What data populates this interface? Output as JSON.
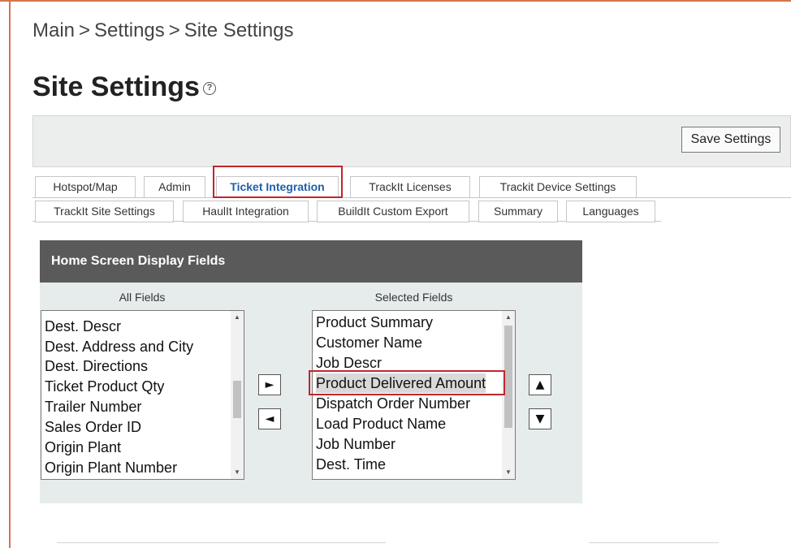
{
  "breadcrumb": {
    "items": [
      "Main",
      "Settings",
      "Site Settings"
    ],
    "separator": ">"
  },
  "page": {
    "title": "Site Settings",
    "help_icon": "?"
  },
  "toolbar": {
    "save_label": "Save Settings"
  },
  "tabs": {
    "row1": [
      "Hotspot/Map",
      "Admin",
      "Ticket Integration",
      "TrackIt Licenses",
      "Trackit Device Settings"
    ],
    "row2": [
      "TrackIt Site Settings",
      "HaulIt Integration",
      "BuildIt Custom Export",
      "Summary",
      "Languages"
    ],
    "active": "Ticket Integration"
  },
  "panel": {
    "title": "Home Screen Display Fields",
    "all_fields_label": "All Fields",
    "selected_fields_label": "Selected Fields",
    "all_fields": [
      "Dest. Descr",
      "Dest. Address and City",
      "Dest. Directions",
      "Ticket Product Qty",
      "Trailer Number",
      "Sales Order ID",
      "Origin Plant",
      "Origin Plant Number"
    ],
    "selected_fields": [
      "Product Summary",
      "Customer Name",
      "Job Descr",
      "Product Delivered Amount",
      "Dispatch Order Number",
      "Load Product Name",
      "Job Number",
      "Dest. Time"
    ],
    "highlighted_field": "Product Delivered Amount",
    "buttons": {
      "add": "►",
      "remove": "◄",
      "move_up": "▲",
      "move_down": "▼"
    }
  },
  "icons": {
    "help": "help-circle-icon",
    "add": "triangle-right-icon",
    "remove": "triangle-left-icon",
    "up": "triangle-up-icon",
    "down": "triangle-down-icon"
  },
  "colors": {
    "frame": "#d2764f",
    "highlight_outline": "#c0262c",
    "active_tab_text": "#1f5fa8",
    "panel_header": "#5a5a5a",
    "panel_body": "#e6ecec"
  }
}
